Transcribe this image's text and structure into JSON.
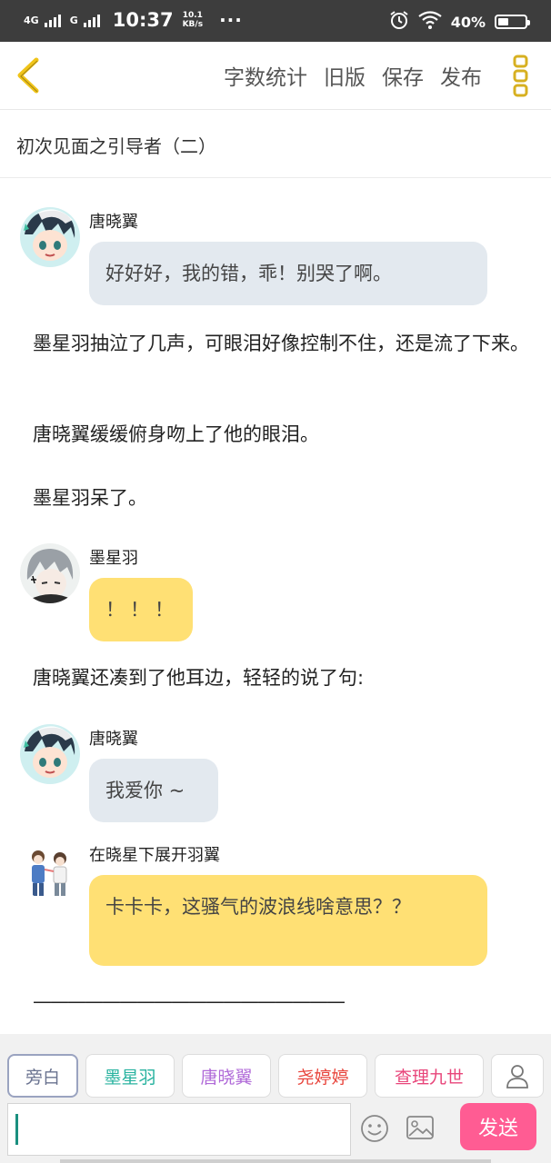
{
  "status_bar": {
    "net1": "4G",
    "net2": "G",
    "time": "10:37",
    "speed_value": "10.1",
    "speed_unit": "KB/s",
    "dots": "···",
    "battery_text": "40%",
    "battery_level": 0.4
  },
  "toolbar": {
    "word_count": "字数统计",
    "old_version": "旧版",
    "save": "保存",
    "publish": "发布"
  },
  "chapter_title": "初次见面之引导者（二）",
  "content": {
    "msg1": {
      "speaker": "唐晓翼",
      "text": "好好好，我的错，乖！别哭了啊。"
    },
    "narr1": "墨星羽抽泣了几声，可眼泪好像控制不住，还是流了下来。",
    "narr2": "唐晓翼缓缓俯身吻上了他的眼泪。",
    "narr3": "墨星羽呆了。",
    "msg2": {
      "speaker": "墨星羽",
      "text": "！！！"
    },
    "narr4": "唐晓翼还凑到了他耳边，轻轻的说了句:",
    "msg3": {
      "speaker": "唐晓翼",
      "text": "我爱你 ~"
    },
    "msg4": {
      "speaker": "在晓星下展开羽翼",
      "text": "卡卡卡，这骚气的波浪线啥意思？？"
    },
    "divider": "——————————————————"
  },
  "characters": [
    {
      "label": "旁白",
      "color": "#7a84a0"
    },
    {
      "label": "墨星羽",
      "color": "#29b3a0"
    },
    {
      "label": "唐晓翼",
      "color": "#b06ad8"
    },
    {
      "label": "尧婷婷",
      "color": "#e8453c"
    },
    {
      "label": "查理九世",
      "color": "#e8457a"
    }
  ],
  "input": {
    "value": ""
  },
  "send_label": "发送",
  "colors": {
    "accent_pink": "#ff5c93",
    "bubble_yellow": "#ffe074",
    "bubble_blue": "#e3e9ef",
    "back_yellow": "#f0c419"
  }
}
